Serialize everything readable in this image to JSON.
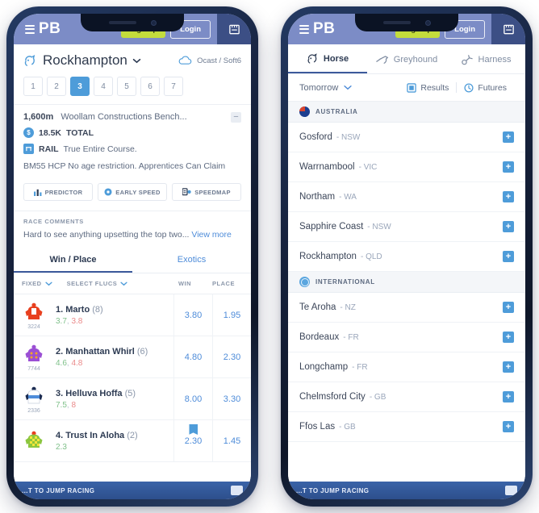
{
  "header": {
    "logo_text": "PB",
    "menu_icon": "hamburger-menu-icon",
    "signup_label": "Sign up",
    "login_label": "Login",
    "betslip_icon": "betslip-icon"
  },
  "left_phone": {
    "venue": {
      "icon": "horse-racing-icon",
      "name": "Rockhampton",
      "chevron_icon": "chevron-down-icon",
      "weather_icon": "cloud-icon",
      "weather_text": "Ocast / Soft6"
    },
    "race_numbers": [
      "1",
      "2",
      "3",
      "4",
      "5",
      "6",
      "7"
    ],
    "active_race": "3",
    "race_info": {
      "distance": "1,600m",
      "race_name": "Woollam Constructions Bench...",
      "collapse_icon": "collapse-icon",
      "collapse_glyph": "−",
      "prize_icon": "dollar-icon",
      "prize_glyph": "$",
      "prize_value": "18.5K",
      "prize_label": "TOTAL",
      "rail_icon": "rail-icon",
      "rail_label": "RAIL",
      "rail_value": "True Entire Course.",
      "conditions": "BM55 HCP No age restriction.  Apprentices Can Claim"
    },
    "tools": [
      {
        "label": "PREDICTOR",
        "icon": "bar-chart-icon"
      },
      {
        "label": "EARLY SPEED",
        "icon": "speed-dial-icon"
      },
      {
        "label": "SPEEDMAP",
        "icon": "speedmap-icon"
      }
    ],
    "comments": {
      "heading": "RACE COMMENTS",
      "text": "Hard to see anything upsetting the top two...",
      "view_more": "View more"
    },
    "bet_tabs": [
      {
        "label": "Win / Place",
        "active": true
      },
      {
        "label": "Exotics",
        "active": false
      }
    ],
    "columns": {
      "fixed_label": "FIXED",
      "fixed_chevron": "chevron-down-icon",
      "flucs_label": "SELECT FLUCS",
      "flucs_chevron": "chevron-down-icon",
      "win_label": "WIN",
      "place_label": "PLACE"
    },
    "runners": [
      {
        "saddle": "1.",
        "name": "Marto",
        "barrier": "(8)",
        "form": "3224",
        "fluc_open": "3.7",
        "fluc_last": "3.8",
        "win": "3.80",
        "place": "1.95",
        "bookmark": false,
        "silk": {
          "body": "#e8401f",
          "sleeve": "#e8401f",
          "cap": "#e8401f",
          "pattern": "white-panel"
        }
      },
      {
        "saddle": "2.",
        "name": "Manhattan Whirl",
        "barrier": "(6)",
        "form": "7744",
        "fluc_open": "4.6",
        "fluc_last": "4.8",
        "win": "4.80",
        "place": "2.30",
        "bookmark": false,
        "silk": {
          "body": "#9b4fd4",
          "sleeve": "#9b4fd4",
          "cap": "#9b4fd4",
          "pattern": "orange-spots"
        }
      },
      {
        "saddle": "3.",
        "name": "Helluva Hoffa",
        "barrier": "(5)",
        "form": "2336",
        "fluc_open": "7.5",
        "fluc_last": "8",
        "win": "8.00",
        "place": "3.30",
        "bookmark": false,
        "silk": {
          "body": "#ffffff",
          "sleeve": "#1b2c52",
          "cap": "#1b2c52",
          "pattern": "blue-band"
        }
      },
      {
        "saddle": "4.",
        "name": "Trust In Aloha",
        "barrier": "(2)",
        "form": "",
        "fluc_open": "2.3",
        "fluc_last": "",
        "win": "2.30",
        "place": "1.45",
        "bookmark": true,
        "silk": {
          "body": "#8cc63f",
          "sleeve": "#8cc63f",
          "cap": "#e8401f",
          "pattern": "yellow-check"
        }
      }
    ],
    "bottom_bar": {
      "text": "...T TO JUMP RACING",
      "action_icon": "bet-button-icon"
    }
  },
  "right_phone": {
    "category_tabs": [
      {
        "label": "Horse",
        "icon": "horse-icon",
        "active": true
      },
      {
        "label": "Greyhound",
        "icon": "greyhound-icon",
        "active": false
      },
      {
        "label": "Harness",
        "icon": "harness-icon",
        "active": false
      }
    ],
    "filter_bar": {
      "day_label": "Tomorrow",
      "day_chevron": "chevron-down-icon",
      "results_label": "Results",
      "results_icon": "results-icon",
      "futures_label": "Futures",
      "futures_icon": "futures-icon"
    },
    "groups": [
      {
        "title": "AUSTRALIA",
        "flag_icon": "australia-flag-icon",
        "meetings": [
          {
            "name": "Gosford",
            "state": "- NSW",
            "add_icon": "plus-icon",
            "add_glyph": "+"
          },
          {
            "name": "Warrnambool",
            "state": "- VIC",
            "add_icon": "plus-icon",
            "add_glyph": "+"
          },
          {
            "name": "Northam",
            "state": "- WA",
            "add_icon": "plus-icon",
            "add_glyph": "+"
          },
          {
            "name": "Sapphire Coast",
            "state": "- NSW",
            "add_icon": "plus-icon",
            "add_glyph": "+"
          },
          {
            "name": "Rockhampton",
            "state": "- QLD",
            "add_icon": "plus-icon",
            "add_glyph": "+"
          }
        ]
      },
      {
        "title": "INTERNATIONAL",
        "flag_icon": "globe-icon",
        "meetings": [
          {
            "name": "Te Aroha",
            "state": "- NZ",
            "add_icon": "plus-icon",
            "add_glyph": "+"
          },
          {
            "name": "Bordeaux",
            "state": "- FR",
            "add_icon": "plus-icon",
            "add_glyph": "+"
          },
          {
            "name": "Longchamp",
            "state": "- FR",
            "add_icon": "plus-icon",
            "add_glyph": "+"
          },
          {
            "name": "Chelmsford City",
            "state": "- GB",
            "add_icon": "plus-icon",
            "add_glyph": "+"
          },
          {
            "name": "Ffos Las",
            "state": "- GB",
            "add_icon": "plus-icon",
            "add_glyph": "+"
          }
        ]
      }
    ],
    "bottom_bar": {
      "text": "...T TO JUMP RACING",
      "action_icon": "bet-button-icon"
    }
  },
  "colors": {
    "header_bg": "#7c8cc6",
    "accent_blue": "#4e9cd9",
    "signup_green": "#c3dc3c",
    "tab_underline": "#3d5a9b",
    "text_dark": "#2c3a52",
    "text_muted": "#8b97aa"
  }
}
